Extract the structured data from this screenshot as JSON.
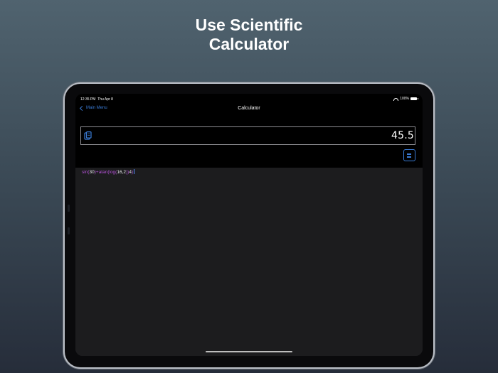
{
  "headline": {
    "line1": "Use Scientific",
    "line2": "Calculator"
  },
  "status_bar": {
    "time": "12:35 PM",
    "date": "Thu Apr 8",
    "battery": "100%"
  },
  "nav": {
    "back_label": "Main Menu",
    "title": "Calculator"
  },
  "display": {
    "result": "45.5",
    "clipboard_icon": "clipboard-icon",
    "equals_icon": "equals-icon"
  },
  "expression": {
    "tokens": [
      {
        "text": "sin(",
        "kind": "fn"
      },
      {
        "text": "30",
        "kind": "num"
      },
      {
        "text": ")+",
        "kind": "fn"
      },
      {
        "text": "atan(log(",
        "kind": "fn"
      },
      {
        "text": "16,2",
        "kind": "num"
      },
      {
        "text": "))",
        "kind": "fn"
      },
      {
        "text": "4",
        "kind": "num"
      },
      {
        "text": ")",
        "kind": "fn"
      }
    ]
  },
  "colors": {
    "accent": "#3a7bd5",
    "function": "#b553d8",
    "number": "#ebebf0",
    "background": "#1c1c1e"
  }
}
